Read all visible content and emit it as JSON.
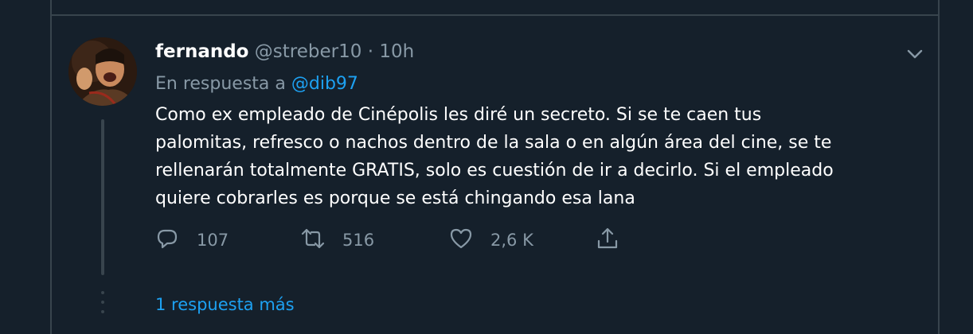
{
  "tweet": {
    "author_name": "fernando",
    "author_handle": "@streber10",
    "separator": "·",
    "timestamp": "10h",
    "reply_prefix": "En respuesta a",
    "reply_mention": "@dib97",
    "text": "Como ex empleado de Cinépolis les diré un secreto. Si se te caen tus\npalomitas, refresco o nachos dentro de la sala o en algún área del cine, se te\nrellenarán totalmente GRATIS, solo es cuestión de ir a decirlo. Si el empleado\nquiere cobrarles es porque se está chingando esa lana",
    "actions": {
      "replies": "107",
      "retweets": "516",
      "likes": "2,6 K"
    }
  },
  "thread": {
    "more_replies_label": "1 respuesta más"
  },
  "icons": {
    "reply": "reply-icon",
    "retweet": "retweet-icon",
    "like": "heart-icon",
    "share": "share-icon",
    "menu": "chevron-down-icon"
  },
  "colors": {
    "background": "#15202b",
    "border": "#38444d",
    "text_primary": "#ffffff",
    "text_secondary": "#8899a6",
    "accent": "#1da1f2"
  }
}
